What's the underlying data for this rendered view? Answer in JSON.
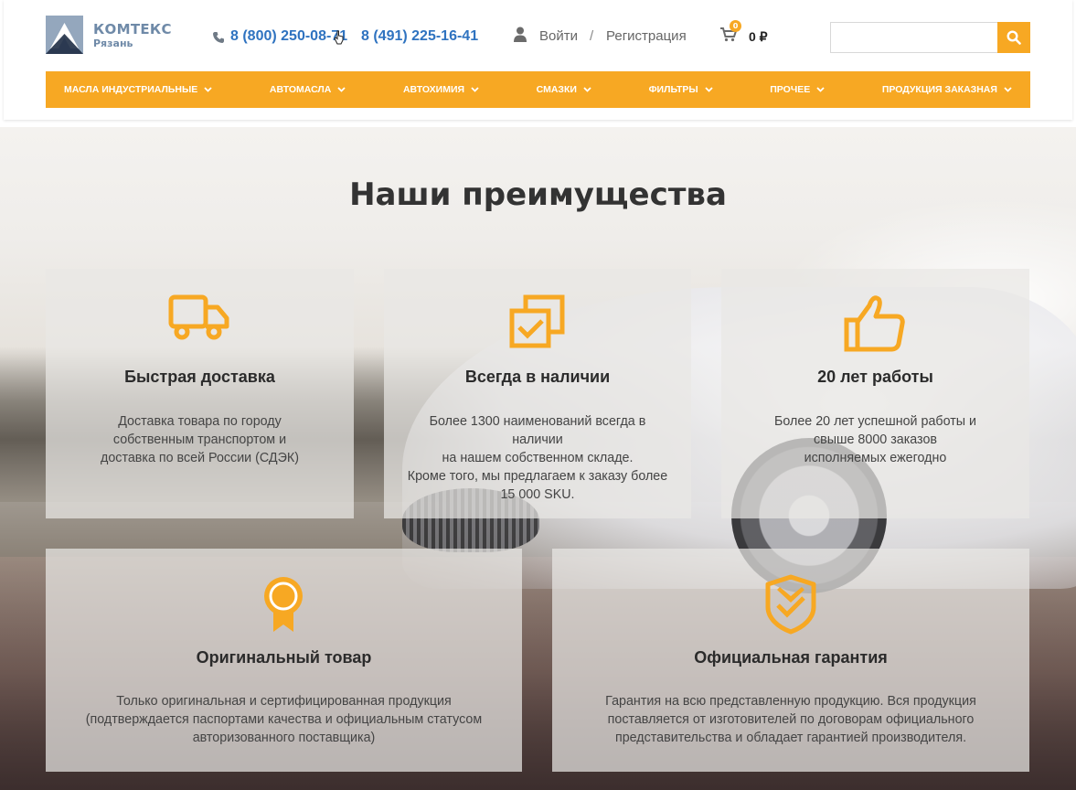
{
  "header": {
    "logo": {
      "name": "КОМТЕКС",
      "city": "Рязань"
    },
    "phones": [
      "8 (800) 250-08-71",
      "8 (491) 225-16-41"
    ],
    "auth": {
      "login": "Войти",
      "separator": "/",
      "register": "Регистрация"
    },
    "cart": {
      "count": "0",
      "total": "0 ₽"
    },
    "search": {
      "value": "",
      "placeholder": ""
    }
  },
  "nav": {
    "items": [
      {
        "label": "Масла индустриальные"
      },
      {
        "label": "Автомасла"
      },
      {
        "label": "Автохимия"
      },
      {
        "label": "Смазки"
      },
      {
        "label": "Фильтры"
      },
      {
        "label": "Прочее"
      },
      {
        "label": "Продукция заказная"
      }
    ]
  },
  "advantages": {
    "title": "Наши преимущества",
    "cards": [
      {
        "icon": "truck-icon",
        "title": "Быстрая доставка",
        "lines": [
          "Доставка товара по городу",
          "собственным транспортом и",
          "доставка по всей России (СДЭК)"
        ]
      },
      {
        "icon": "stock-check-icon",
        "title": "Всегда в наличии",
        "lines": [
          "Более 1300 наименований всегда в наличии",
          "на нашем собственном складе.",
          "Кроме того, мы предлагаем к заказу более",
          "15 000 SKU."
        ]
      },
      {
        "icon": "thumbs-up-icon",
        "title": "20 лет работы",
        "lines": [
          "Более 20 лет успешной работы и",
          "свыше 8000 заказов",
          "исполняемых ежегодно"
        ]
      },
      {
        "icon": "award-medal-icon",
        "title": "Оригинальный товар",
        "lines": [
          "Только оригинальная и сертифицированная продукция",
          "(подтверждается паспортами качества и официальным статусом",
          "авторизованного поставщика)"
        ]
      },
      {
        "icon": "shield-check-icon",
        "title": "Официальная гарантия",
        "lines": [
          "Гарантия на всю представленную продукцию. Вся продукция",
          "поставляется от изготовителей по договорам официального",
          "представительства и обладает гарантией производителя."
        ]
      }
    ]
  },
  "colors": {
    "accent": "#f7a823",
    "phone": "#2f73c0",
    "logo": "#6f8aa8"
  }
}
